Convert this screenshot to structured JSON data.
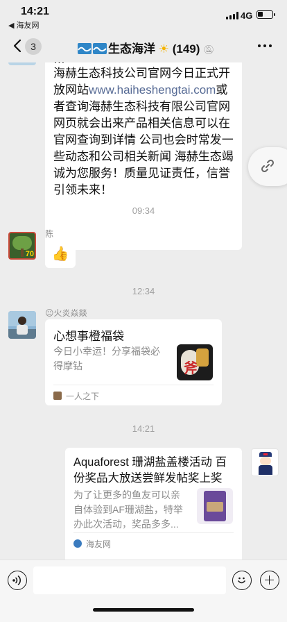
{
  "status_bar": {
    "time": "14:21",
    "back_app": "◀ 海友网",
    "network": "4G",
    "battery_level": 0.35
  },
  "nav": {
    "unread_count": "3",
    "group_name": "生态海洋",
    "member_count": "(149)",
    "icons": [
      "back-chevron-icon",
      "wave-icon",
      "sun-icon",
      "mute-icon",
      "more-icon"
    ]
  },
  "messages": {
    "first_text": {
      "clipped_line": "…",
      "text_before_link": "海赫生态科技公司官网今日正式开放网站",
      "link": "www.haiheshengtai.com",
      "text_after_link": "或者查询海赫生态科技有限公司官网 网页就会出来产品相关信息可以在官网查询到详情 公司也会时常发一些动态和公司相关新闻 海赫生态竭诚为您服务！质量见证责任，信誉引领未来！"
    },
    "time_1": "09:34",
    "chen": {
      "name": "陈",
      "avatar_badge": "70",
      "emoji": "👍"
    },
    "time_2": "12:34",
    "fire": {
      "name": "😐火炎焱燚",
      "card_title": "心想事橙福袋",
      "card_desc": "今日小幸运！分享福袋必得摩钻",
      "thumb_glyph": "斧",
      "source": "一人之下"
    },
    "time_3": "14:21",
    "aqua": {
      "card_title": "Aquaforest 珊湖盐盖楼活动 百份奖品大放送尝鲜发帖奖上奖",
      "card_desc": "为了让更多的鱼友可以亲自体验到AF珊湖盐，特举办此次活动，奖品多多...",
      "source": "海友网"
    }
  },
  "input_bar": {
    "icons": [
      "voice-icon",
      "emoji-icon",
      "plus-icon"
    ]
  }
}
